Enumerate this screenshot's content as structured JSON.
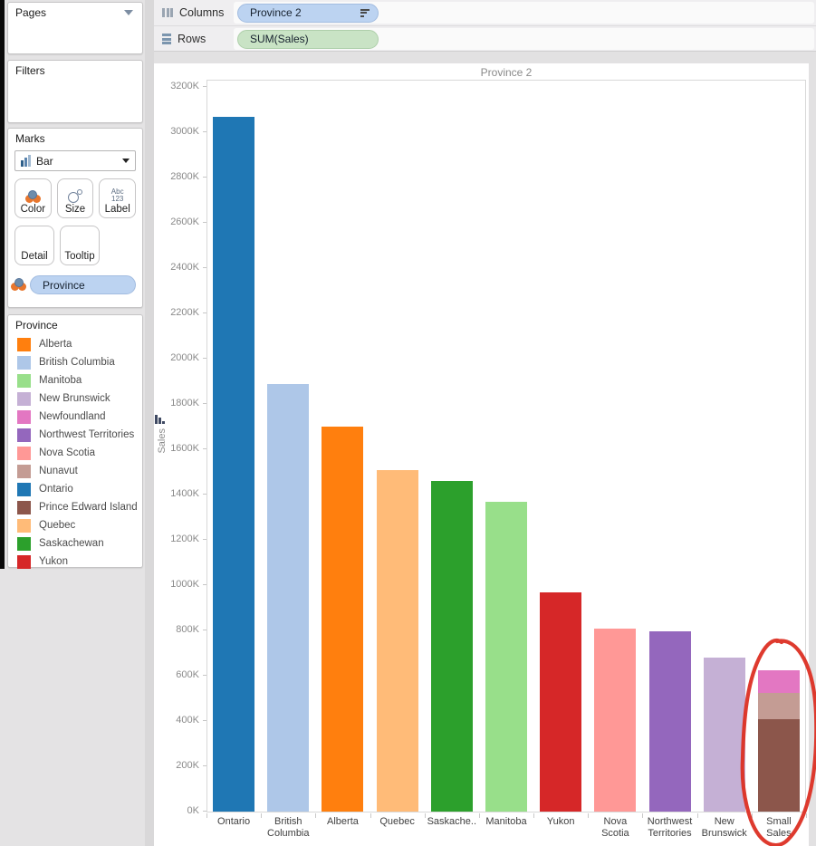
{
  "shelves": {
    "columns_label": "Columns",
    "rows_label": "Rows",
    "columns_pill": "Province 2",
    "rows_pill": "SUM(Sales)"
  },
  "sidebar": {
    "pages_title": "Pages",
    "filters_title": "Filters",
    "marks": {
      "title": "Marks",
      "mark_type": "Bar",
      "color_label": "Color",
      "size_label": "Size",
      "label_label": "Label",
      "detail_label": "Detail",
      "tooltip_label": "Tooltip",
      "pill": "Province"
    },
    "legend": {
      "title": "Province",
      "items": [
        {
          "label": "Alberta",
          "color": "#FF7F0E"
        },
        {
          "label": "British Columbia",
          "color": "#AEC7E8"
        },
        {
          "label": "Manitoba",
          "color": "#98DF8A"
        },
        {
          "label": "New Brunswick",
          "color": "#C5B0D5"
        },
        {
          "label": "Newfoundland",
          "color": "#E377C2"
        },
        {
          "label": "Northwest Territories",
          "color": "#9467BD"
        },
        {
          "label": "Nova Scotia",
          "color": "#FF9896"
        },
        {
          "label": "Nunavut",
          "color": "#C49C94"
        },
        {
          "label": "Ontario",
          "color": "#1F77B4"
        },
        {
          "label": "Prince Edward Island",
          "color": "#8C564B"
        },
        {
          "label": "Quebec",
          "color": "#FFBB78"
        },
        {
          "label": "Saskachewan",
          "color": "#2CA02C"
        },
        {
          "label": "Yukon",
          "color": "#D62728"
        }
      ]
    }
  },
  "chart_data": {
    "type": "bar",
    "title": "Province 2",
    "ylabel": "Sales",
    "ylim": [
      0,
      3200
    ],
    "ytick_step": 200,
    "ytick_suffix": "K",
    "grid": false,
    "units": "K (thousands)",
    "bars": [
      {
        "category": "Ontario",
        "label_lines": [
          "Ontario"
        ],
        "value": 3070,
        "color": "#1F77B4"
      },
      {
        "category": "British Columbia",
        "label_lines": [
          "British",
          "Columbia"
        ],
        "value": 1890,
        "color": "#AEC7E8"
      },
      {
        "category": "Alberta",
        "label_lines": [
          "Alberta"
        ],
        "value": 1700,
        "color": "#FF7F0E"
      },
      {
        "category": "Quebec",
        "label_lines": [
          "Quebec"
        ],
        "value": 1510,
        "color": "#FFBB78"
      },
      {
        "category": "Saskachewan",
        "label_lines": [
          "Saskache.."
        ],
        "value": 1460,
        "color": "#2CA02C"
      },
      {
        "category": "Manitoba",
        "label_lines": [
          "Manitoba"
        ],
        "value": 1370,
        "color": "#98DF8A"
      },
      {
        "category": "Yukon",
        "label_lines": [
          "Yukon"
        ],
        "value": 970,
        "color": "#D62728"
      },
      {
        "category": "Nova Scotia",
        "label_lines": [
          "Nova",
          "Scotia"
        ],
        "value": 810,
        "color": "#FF9896"
      },
      {
        "category": "Northwest Territories",
        "label_lines": [
          "Northwest",
          "Territories"
        ],
        "value": 795,
        "color": "#9467BD"
      },
      {
        "category": "New Brunswick",
        "label_lines": [
          "New",
          "Brunswick"
        ],
        "value": 680,
        "color": "#C5B0D5"
      },
      {
        "category": "Small Sales",
        "label_lines": [
          "Small",
          "Sales"
        ],
        "value": 625,
        "segments": [
          {
            "name": "Prince Edward Island",
            "value": 410,
            "color": "#8C564B"
          },
          {
            "name": "Nunavut",
            "value": 115,
            "color": "#C49C94"
          },
          {
            "name": "Newfoundland",
            "value": 100,
            "color": "#E377C2"
          }
        ]
      }
    ],
    "annotation": {
      "shape": "hand-drawn red circle",
      "target": "Small Sales bar",
      "color": "#dc2f23"
    }
  }
}
